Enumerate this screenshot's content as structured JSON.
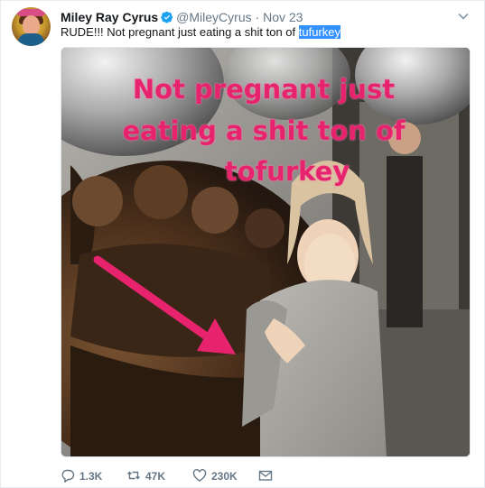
{
  "tweet": {
    "author_name": "Miley Ray Cyrus",
    "handle": "@MileyCyrus",
    "separator": "·",
    "date": "Nov 23",
    "text_before": "RUDE!!! Not pregnant just eating a shit ton of ",
    "text_highlight": "tufurkey"
  },
  "media": {
    "overlay_lines": [
      "Not pregnant just",
      "eating a shit ton of",
      "tofurkey"
    ],
    "overlay_color": "#e8236e"
  },
  "actions": {
    "reply_count": "1.3K",
    "retweet_count": "47K",
    "like_count": "230K"
  },
  "colors": {
    "verified_badge": "#1da1f2",
    "secondary_text": "#657786",
    "selection_highlight": "#3390ff"
  },
  "icons": [
    "verified-badge-icon",
    "chevron-down-icon",
    "reply-icon",
    "retweet-icon",
    "heart-icon",
    "envelope-icon"
  ]
}
